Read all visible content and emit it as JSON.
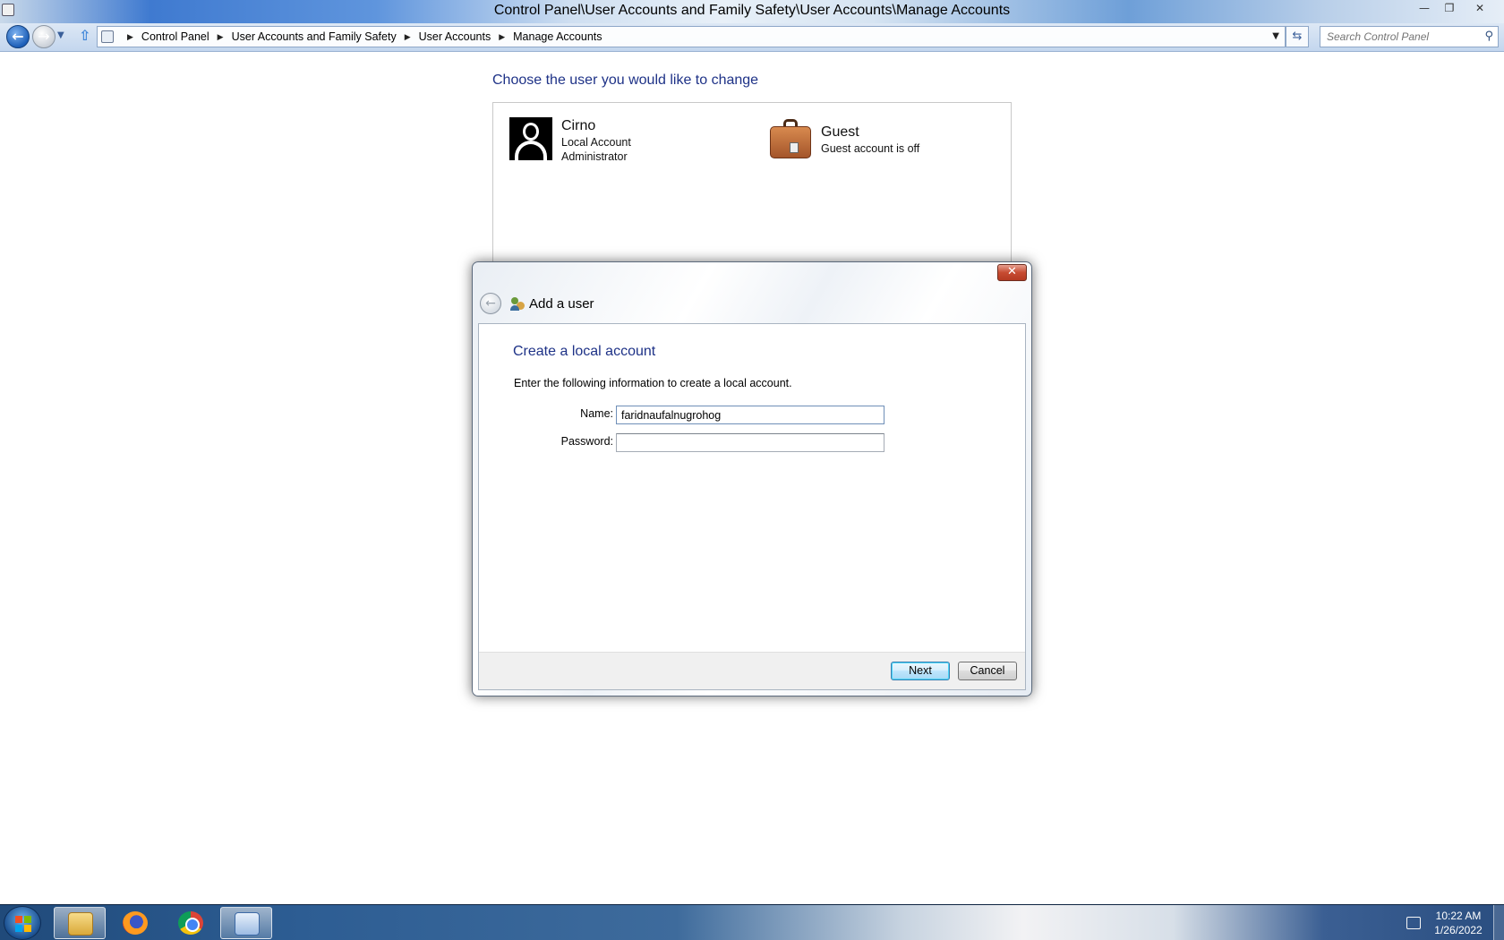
{
  "window": {
    "title": "Control Panel\\User Accounts and Family Safety\\User Accounts\\Manage Accounts",
    "minimize_icon": "minimize-icon",
    "maximize_icon": "restore-icon",
    "close_icon": "close-icon"
  },
  "navigation": {
    "breadcrumbs": [
      "Control Panel",
      "User Accounts and Family Safety",
      "User Accounts",
      "Manage Accounts"
    ],
    "search_placeholder": "Search Control Panel"
  },
  "main": {
    "heading": "Choose the user you would like to change",
    "users": [
      {
        "name": "Cirno",
        "line1": "Local Account",
        "line2": "Administrator",
        "icon": "user-silhouette-icon"
      },
      {
        "name": "Guest",
        "line1": "Guest account is off",
        "icon": "suitcase-icon"
      }
    ]
  },
  "dialog": {
    "title": "Add a user",
    "heading": "Create a local account",
    "description": "Enter the following information to create a local account.",
    "name_label": "Name:",
    "name_value": "faridnaufalnugrohog",
    "password_label": "Password:",
    "password_value": "",
    "next_label": "Next",
    "cancel_label": "Cancel"
  },
  "taskbar": {
    "apps": [
      "windows-explorer-icon",
      "firefox-icon",
      "chrome-icon",
      "control-panel-icon"
    ],
    "time": "10:22 AM",
    "date": "1/26/2022"
  }
}
